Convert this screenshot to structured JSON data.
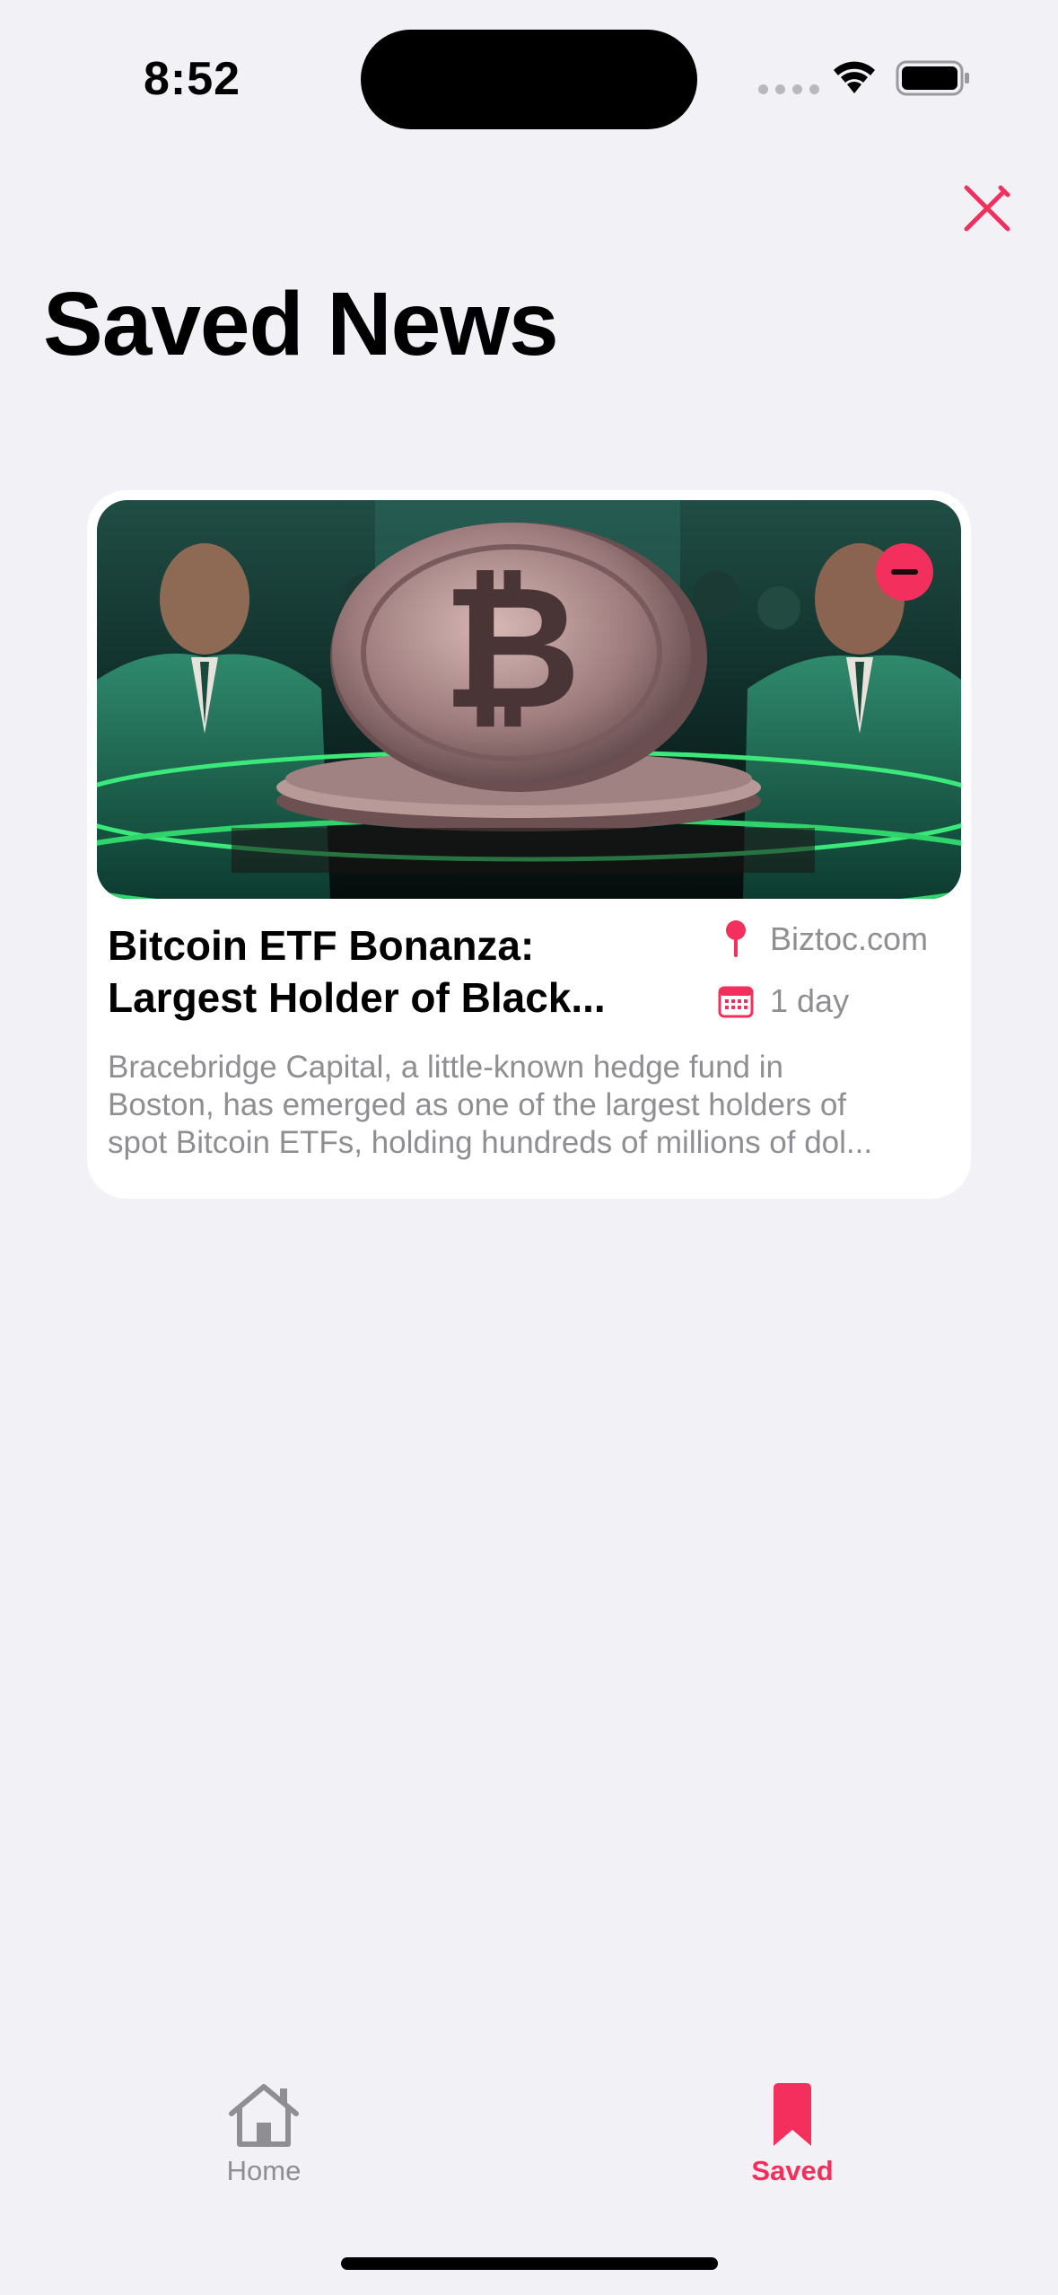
{
  "status_bar": {
    "time": "8:52"
  },
  "header": {
    "title": "Saved News",
    "close_icon": "close-icon"
  },
  "articles": [
    {
      "title_line1": "Bitcoin ETF Bonanza:",
      "title_line2": "Largest Holder of Black...",
      "source": "Biztoc.com",
      "age": "1 day",
      "summary_line1": "Bracebridge Capital, a little-known hedge fund in",
      "summary_line2": "Boston, has emerged as one of the largest holders of",
      "summary_line3": "spot Bitcoin ETFs, holding hundreds of millions of dol..."
    }
  ],
  "tab_bar": {
    "home_label": "Home",
    "saved_label": "Saved"
  },
  "colors": {
    "accent": "#f3305d",
    "background": "#f2f1f6",
    "secondary_text": "#8e8e93"
  }
}
